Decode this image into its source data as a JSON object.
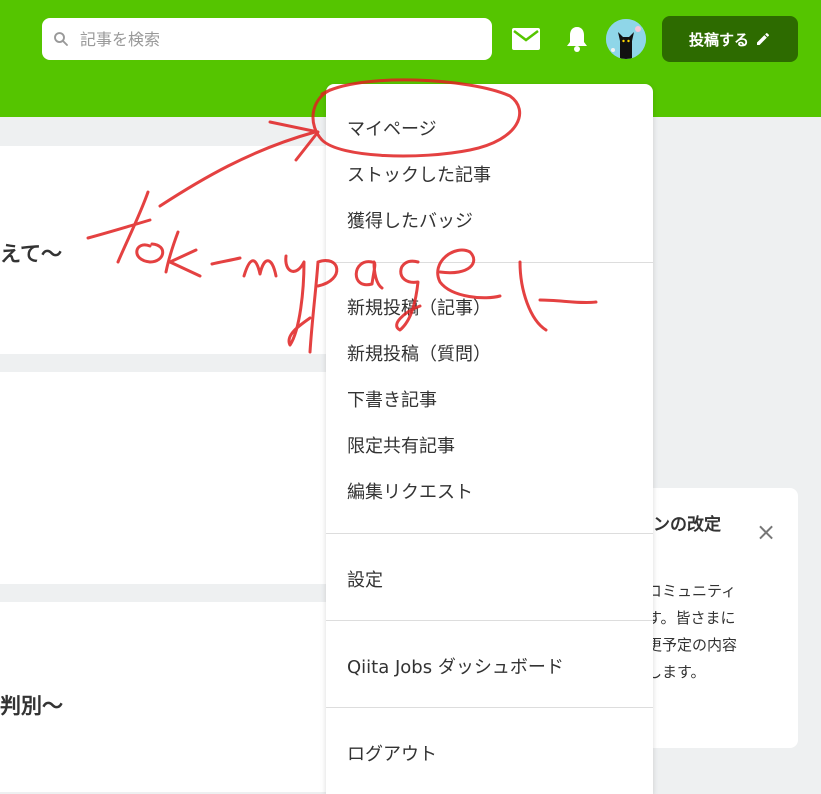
{
  "header": {
    "search": {
      "placeholder": "記事を検索",
      "icon": "search-icon"
    },
    "mail_icon": "mail-icon",
    "bell_icon": "bell-icon",
    "avatar_icon": "cat-avatar",
    "post_button": {
      "label": "投稿する",
      "icon": "pencil-icon"
    },
    "colors": {
      "brand": "#55c500",
      "post_button": "#2d6b00"
    }
  },
  "cards": [
    {
      "title": "えて～"
    },
    {
      "title": ""
    },
    {
      "title": "判別～"
    }
  ],
  "notice": {
    "title": "インの改定",
    "close_icon": "close-icon",
    "lines": [
      "のコミュニティ",
      "ます。皆さまに",
      "変更予定の内容",
      "いします。"
    ]
  },
  "menu": {
    "group1": [
      "マイページ",
      "ストックした記事",
      "獲得したバッジ"
    ],
    "group2": [
      "新規投稿（記事）",
      "新規投稿（質問）",
      "下書き記事",
      "限定共有記事",
      "編集リクエスト"
    ],
    "settings": "設定",
    "jobs": "Qiita Jobs ダッシュボード",
    "logout": "ログアウト"
  },
  "annotation": {
    "text": "to_mypage",
    "color": "#e02020"
  }
}
